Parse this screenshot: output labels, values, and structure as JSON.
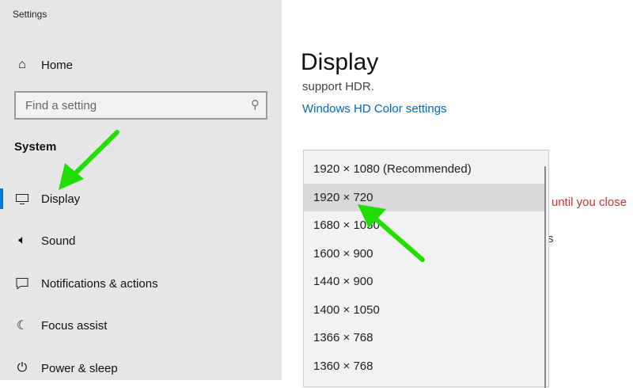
{
  "app_title": "Settings",
  "sidebar": {
    "home": "Home",
    "search_placeholder": "Find a setting",
    "section": "System",
    "items": [
      {
        "label": "Display",
        "icon": "monitor-icon",
        "selected": true
      },
      {
        "label": "Sound",
        "icon": "speaker-icon"
      },
      {
        "label": "Notifications & actions",
        "icon": "notification-icon"
      },
      {
        "label": "Focus assist",
        "icon": "moon-icon"
      },
      {
        "label": "Power & sleep",
        "icon": "power-icon"
      }
    ]
  },
  "main": {
    "title": "Display",
    "hdr_text": "support HDR.",
    "hdr_link": "Windows HD Color settings",
    "warning_fragment": "until you close",
    "fragment": "s",
    "resolution_options": [
      "1920 × 1080 (Recommended)",
      "1920 × 720",
      "1680 × 1050",
      "1600 × 900",
      "1440 × 900",
      "1400 × 1050",
      "1366 × 768",
      "1360 × 768"
    ],
    "highlighted_option": "1920 × 720"
  },
  "colors": {
    "accent": "#0078d7",
    "link": "#0067c0",
    "warning": "#d13438",
    "annotation": "#22dd00"
  }
}
